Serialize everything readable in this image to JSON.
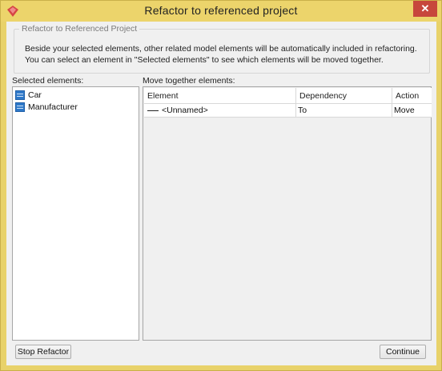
{
  "window": {
    "title": "Refactor to referenced project",
    "close_label": "✕"
  },
  "info": {
    "group_title": "Refactor to Referenced Project",
    "line1": "Beside your selected elements, other related model elements will be automatically included in refactoring.",
    "line2": "You can select an element in \"Selected elements\" to see which elements will be moved together."
  },
  "selected": {
    "label": "Selected elements:",
    "items": [
      {
        "label": "Car",
        "icon": "class-icon"
      },
      {
        "label": "Manufacturer",
        "icon": "class-icon"
      }
    ]
  },
  "move_together": {
    "label": "Move together elements:",
    "columns": [
      "Element",
      "Dependency",
      "Action"
    ],
    "rows": [
      {
        "element": "<Unnamed>",
        "icon": "association-icon",
        "dependency": "To",
        "action": "Move"
      }
    ]
  },
  "buttons": {
    "stop_refactor": "Stop Refactor",
    "continue": "Continue"
  },
  "colors": {
    "frame": "#ecd46b",
    "close_button": "#c7473c",
    "class_icon": "#2f79c9"
  }
}
